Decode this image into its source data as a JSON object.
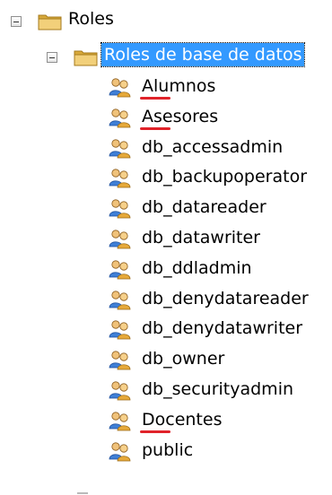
{
  "tree": {
    "root": {
      "label": "Roles",
      "expanded": true
    },
    "child": {
      "label": "Roles de base de datos",
      "expanded": true,
      "selected": true
    },
    "items": [
      {
        "label": "Alumnos",
        "underlined": true
      },
      {
        "label": "Asesores",
        "underlined": true
      },
      {
        "label": "db_accessadmin",
        "underlined": false
      },
      {
        "label": "db_backupoperator",
        "underlined": false
      },
      {
        "label": "db_datareader",
        "underlined": false
      },
      {
        "label": "db_datawriter",
        "underlined": false
      },
      {
        "label": "db_ddladmin",
        "underlined": false
      },
      {
        "label": "db_denydatareader",
        "underlined": false
      },
      {
        "label": "db_denydatawriter",
        "underlined": false
      },
      {
        "label": "db_owner",
        "underlined": false
      },
      {
        "label": "db_securityadmin",
        "underlined": false
      },
      {
        "label": "Docentes",
        "underlined": true
      },
      {
        "label": "public",
        "underlined": false
      }
    ]
  },
  "colors": {
    "selection_bg": "#3399ff",
    "annotation": "#e0232a",
    "folder": "#e8c25a"
  },
  "icons": {
    "folder": "folder-icon",
    "role": "role-users-icon",
    "collapse": "collapse-minus-icon"
  }
}
